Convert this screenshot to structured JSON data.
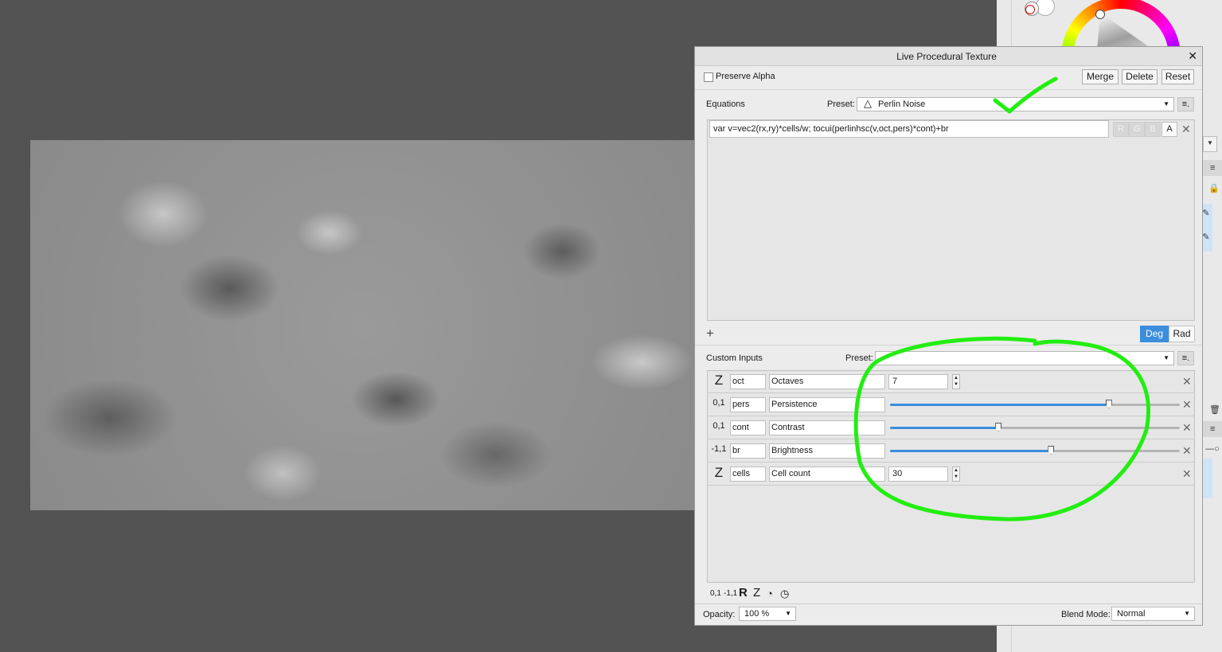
{
  "dialog": {
    "title": "Live Procedural Texture",
    "preserve_alpha_label": "Preserve Alpha",
    "buttons": {
      "merge": "Merge",
      "delete": "Delete",
      "reset": "Reset"
    }
  },
  "equations": {
    "section_label": "Equations",
    "preset_label": "Preset:",
    "preset_value": "Perlin Noise",
    "expression": "var v=vec2(rx,ry)*cells/w; tocui(perlinhsc(v,oct,pers)*cont)+br",
    "channels": [
      "R",
      "G",
      "B",
      "A"
    ],
    "add_symbol": "+",
    "angle_units": {
      "deg": "Deg",
      "rad": "Rad",
      "selected": "Deg"
    }
  },
  "custom_inputs": {
    "section_label": "Custom Inputs",
    "preset_label": "Preset:",
    "preset_value": "",
    "rows": [
      {
        "type": "Z",
        "var": "oct",
        "name": "Octaves",
        "control": "number",
        "value": "7"
      },
      {
        "type": "0,1",
        "var": "pers",
        "name": "Persistence",
        "control": "slider",
        "level": 0.755
      },
      {
        "type": "0,1",
        "var": "cont",
        "name": "Contrast",
        "control": "slider",
        "level": 0.374
      },
      {
        "type": "-1,1",
        "var": "br",
        "name": "Brightness",
        "control": "slider",
        "level": 0.556
      },
      {
        "type": "Z",
        "var": "cells",
        "name": "Cell count",
        "control": "number",
        "value": "30"
      }
    ],
    "type_buttons": [
      "0,1",
      "-1,1",
      "R",
      "Z"
    ]
  },
  "footer": {
    "opacity_label": "Opacity:",
    "opacity_value": "100 %",
    "blend_label": "Blend Mode:",
    "blend_value": "Normal"
  },
  "colors": {
    "accent": "#3b8ddd",
    "annotation": "#22ee11",
    "canvas_bg": "#535353"
  }
}
